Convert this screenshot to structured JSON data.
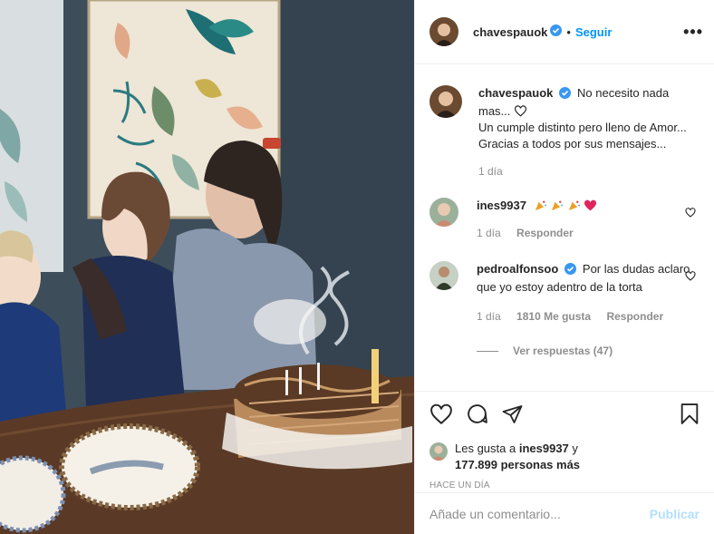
{
  "post": {
    "author": "chavespauok",
    "follow_label": "Seguir",
    "dot": "•",
    "more_label": "•••"
  },
  "caption": {
    "username": "chavespauok",
    "line1": "No necesito nada mas...",
    "line2": "Un cumple distinto pero lleno de Amor...",
    "line3": "Gracias a todos por sus mensajes...",
    "time": "1 día"
  },
  "comments": [
    {
      "username": "ines9937",
      "text": "",
      "emojis": [
        "celebrate-icon",
        "celebrate-icon",
        "celebrate-icon",
        "heart-emoji-icon"
      ],
      "time": "1 día",
      "likes": "",
      "reply_label": "Responder"
    },
    {
      "username": "pedroalfonsoo",
      "text": "Por las dudas aclaro que yo estoy adentro de la torta",
      "time": "1 día",
      "likes": "1810 Me gusta",
      "reply_label": "Responder",
      "view_replies": "Ver respuestas (47)"
    }
  ],
  "likes_summary": {
    "prefix": "Les gusta a",
    "user": "ines9937",
    "suffix": "y",
    "count": "177.899 personas más"
  },
  "time_ago": "HACE UN DÍA",
  "add_comment": {
    "placeholder": "Añade un comentario...",
    "publish_label": "Publicar"
  },
  "colors": {
    "accent": "#0095f6",
    "verified": "#3897f0",
    "muted": "#8e8e8e",
    "publish_disabled": "#b2dffc"
  }
}
